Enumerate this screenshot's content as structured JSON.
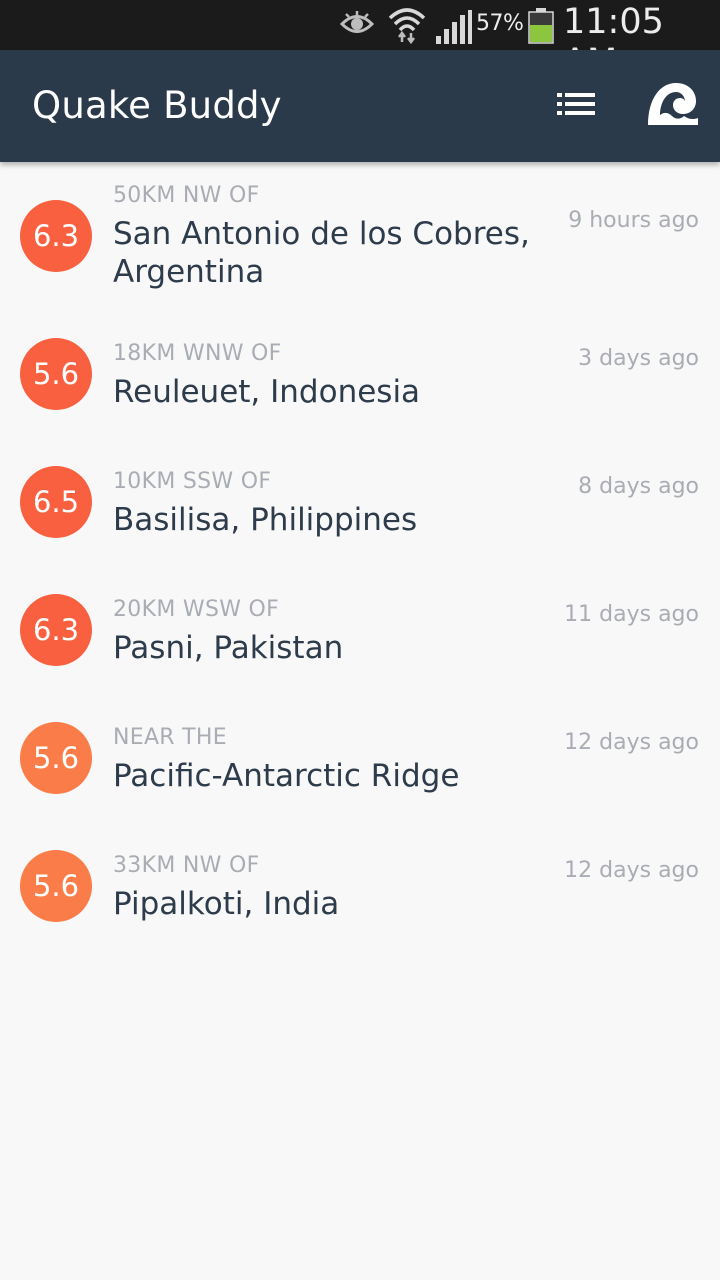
{
  "status_bar": {
    "battery_percent": "57%",
    "time": "11:05 AM",
    "icons": [
      "eye-icon",
      "wifi-icon",
      "signal-icon",
      "battery-icon"
    ],
    "battery_color": "#8cc63e"
  },
  "app_bar": {
    "title": "Quake Buddy",
    "background": "#2b3a4a",
    "actions": [
      "list-icon",
      "wave-icon"
    ]
  },
  "quakes": [
    {
      "magnitude": "6.3",
      "distance": "50KM NW OF",
      "place": "San Antonio de los Cobres, Argentina",
      "time": "9 hours ago",
      "color": "#f8603f"
    },
    {
      "magnitude": "5.6",
      "distance": "18KM WNW OF",
      "place": "Reuleuet, Indonesia",
      "time": "3 days ago",
      "color": "#f8603f"
    },
    {
      "magnitude": "6.5",
      "distance": "10KM SSW OF",
      "place": "Basilisa, Philippines",
      "time": "8 days ago",
      "color": "#f8603f"
    },
    {
      "magnitude": "6.3",
      "distance": "20KM WSW OF",
      "place": "Pasni, Pakistan",
      "time": "11 days ago",
      "color": "#f8603f"
    },
    {
      "magnitude": "5.6",
      "distance": "NEAR THE",
      "place": "Pacific-Antarctic Ridge",
      "time": "12 days ago",
      "color": "#fa7c48"
    },
    {
      "magnitude": "5.6",
      "distance": "33KM NW OF",
      "place": "Pipalkoti, India",
      "time": "12 days ago",
      "color": "#fa7c48"
    }
  ]
}
